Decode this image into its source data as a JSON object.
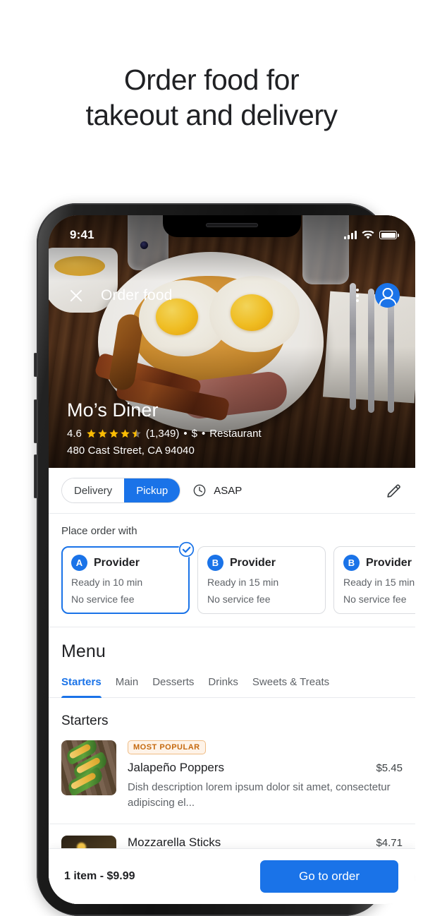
{
  "headline": {
    "line1": "Order food for",
    "line2": "takeout and delivery"
  },
  "status_bar": {
    "time": "9:41"
  },
  "app_bar": {
    "title": "Order food",
    "close_icon": "close-icon",
    "more_icon": "more-vert-icon",
    "avatar_icon": "account-avatar-icon"
  },
  "restaurant": {
    "name": "Mo’s Diner",
    "rating": "4.6",
    "stars_filled": 4,
    "stars_half": 1,
    "review_count": "(1,349)",
    "price_level": "$",
    "category": "Restaurant",
    "separator": "•",
    "address": "480 Cast Street, CA 94040"
  },
  "mode_row": {
    "options": [
      {
        "label": "Delivery",
        "selected": false
      },
      {
        "label": "Pickup",
        "selected": true
      }
    ],
    "time_icon": "clock-icon",
    "time_label": "ASAP",
    "edit_icon": "pencil-edit-icon"
  },
  "providers": {
    "label": "Place order with",
    "items": [
      {
        "badge": "A",
        "name": "Provider",
        "ready": "Ready in 10 min",
        "fee": "No service fee",
        "selected": true
      },
      {
        "badge": "B",
        "name": "Provider",
        "ready": "Ready in 15 min",
        "fee": "No service fee",
        "selected": false
      },
      {
        "badge": "B",
        "name": "Provider",
        "ready": "Ready in 15 min",
        "fee": "No service fee",
        "selected": false
      }
    ]
  },
  "menu": {
    "title": "Menu",
    "tabs": [
      {
        "label": "Starters",
        "active": true
      },
      {
        "label": "Main",
        "active": false
      },
      {
        "label": "Desserts",
        "active": false
      },
      {
        "label": "Drinks",
        "active": false
      },
      {
        "label": "Sweets & Treats",
        "active": false
      }
    ],
    "category_title": "Starters",
    "items": [
      {
        "badge": "MOST POPULAR",
        "name": "Jalapeño Poppers",
        "price": "$5.45",
        "description": "Dish description lorem ipsum dolor sit amet, consectetur adipiscing el...",
        "thumb": "jalapeno-poppers-thumbnail"
      },
      {
        "badge": "",
        "name": "Mozzarella Sticks",
        "price": "$4.71",
        "description": "",
        "thumb": "mozzarella-sticks-thumbnail"
      }
    ]
  },
  "bottom_bar": {
    "summary": "1 item - $9.99",
    "cta": "Go to order"
  },
  "colors": {
    "accent": "#1a73e8",
    "star": "#fbbc04",
    "badge_text": "#c5690f",
    "badge_bg": "#fef3e8",
    "text_primary": "#202124",
    "text_secondary": "#5f6368"
  }
}
